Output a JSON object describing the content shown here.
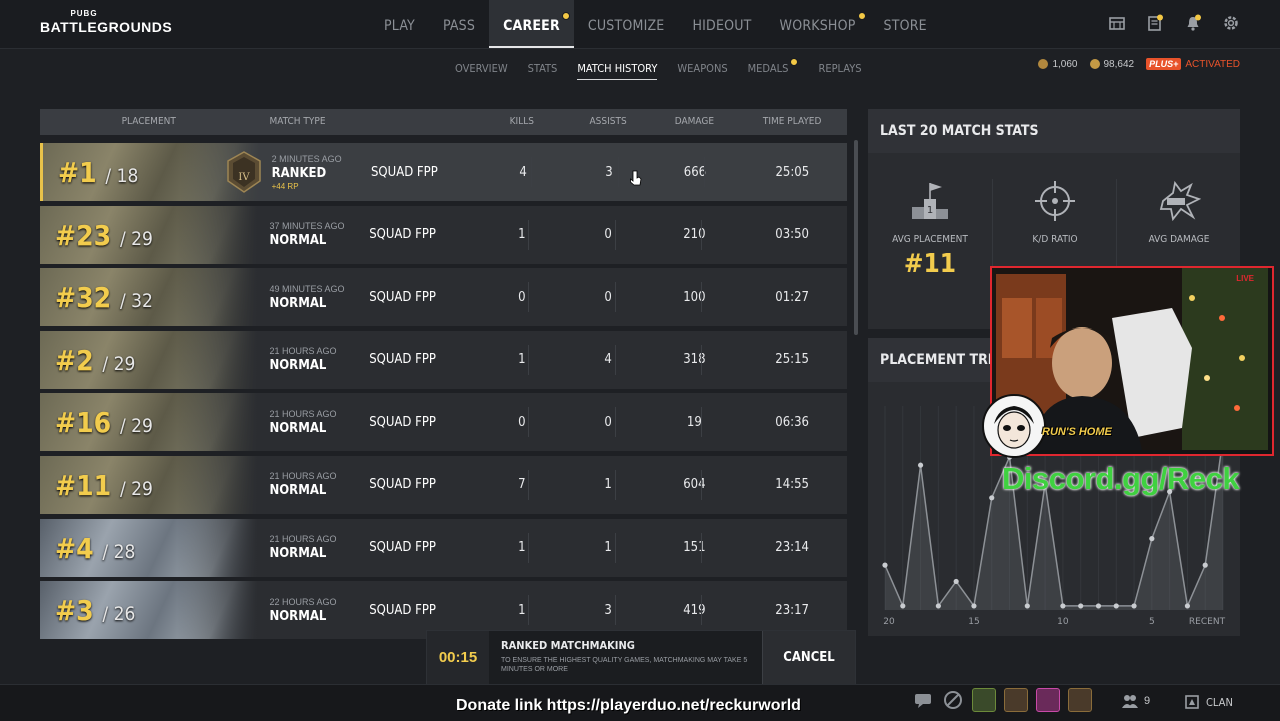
{
  "logo": {
    "small": "PUBG",
    "big": "BATTLEGROUNDS"
  },
  "main_nav": [
    {
      "label": "PLAY",
      "active": false,
      "dot": false
    },
    {
      "label": "PASS",
      "active": false,
      "dot": false
    },
    {
      "label": "CAREER",
      "active": true,
      "dot": true
    },
    {
      "label": "CUSTOMIZE",
      "active": false,
      "dot": false
    },
    {
      "label": "HIDEOUT",
      "active": false,
      "dot": false
    },
    {
      "label": "WORKSHOP",
      "active": false,
      "dot": true
    },
    {
      "label": "STORE",
      "active": false,
      "dot": false
    }
  ],
  "top_icons": [
    "inventory-icon",
    "mission-icon",
    "notification-bell-icon",
    "gear-icon"
  ],
  "sub_nav": [
    {
      "label": "OVERVIEW",
      "active": false
    },
    {
      "label": "STATS",
      "active": false
    },
    {
      "label": "MATCH HISTORY",
      "active": true
    },
    {
      "label": "WEAPONS",
      "active": false
    },
    {
      "label": "MEDALS",
      "active": false,
      "dot": true
    },
    {
      "label": "REPLAYS",
      "active": false
    }
  ],
  "currency": {
    "bp": "1,060",
    "g_coin": "98,642",
    "plus_label": "PLUS+",
    "plus_status": "ACTIVATED"
  },
  "table": {
    "headers": {
      "placement": "PLACEMENT",
      "match_type": "MATCH TYPE",
      "kills": "KILLS",
      "assists": "ASSISTS",
      "damage": "DAMAGE",
      "time_played": "TIME PLAYED"
    },
    "rows": [
      {
        "place": "#1",
        "total": "/ 18",
        "time_ago": "2 MINUTES AGO",
        "type": "RANKED",
        "rp": "+44 RP",
        "mode": "SQUAD FPP",
        "kills": "4",
        "assists": "3",
        "damage": "666",
        "time": "25:05",
        "map": "erangel",
        "badge": "IV"
      },
      {
        "place": "#23",
        "total": "/ 29",
        "time_ago": "37 MINUTES AGO",
        "type": "NORMAL",
        "mode": "SQUAD FPP",
        "kills": "1",
        "assists": "0",
        "damage": "210",
        "time": "03:50",
        "map": "erangel"
      },
      {
        "place": "#32",
        "total": "/ 32",
        "time_ago": "49 MINUTES AGO",
        "type": "NORMAL",
        "mode": "SQUAD FPP",
        "kills": "0",
        "assists": "0",
        "damage": "100",
        "time": "01:27",
        "map": "erangel"
      },
      {
        "place": "#2",
        "total": "/ 29",
        "time_ago": "21 HOURS AGO",
        "type": "NORMAL",
        "mode": "SQUAD FPP",
        "kills": "1",
        "assists": "4",
        "damage": "318",
        "time": "25:15",
        "map": "erangel"
      },
      {
        "place": "#16",
        "total": "/ 29",
        "time_ago": "21 HOURS AGO",
        "type": "NORMAL",
        "mode": "SQUAD FPP",
        "kills": "0",
        "assists": "0",
        "damage": "19",
        "time": "06:36",
        "map": "erangel"
      },
      {
        "place": "#11",
        "total": "/ 29",
        "time_ago": "21 HOURS AGO",
        "type": "NORMAL",
        "mode": "SQUAD FPP",
        "kills": "7",
        "assists": "1",
        "damage": "604",
        "time": "14:55",
        "map": "erangel"
      },
      {
        "place": "#4",
        "total": "/ 28",
        "time_ago": "21 HOURS AGO",
        "type": "NORMAL",
        "mode": "SQUAD FPP",
        "kills": "1",
        "assists": "1",
        "damage": "151",
        "time": "23:14",
        "map": "vikendi"
      },
      {
        "place": "#3",
        "total": "/ 26",
        "time_ago": "22 HOURS AGO",
        "type": "NORMAL",
        "mode": "SQUAD FPP",
        "kills": "1",
        "assists": "3",
        "damage": "419",
        "time": "23:17",
        "map": "vikendi"
      }
    ]
  },
  "last20": {
    "title": "LAST 20 MATCH STATS",
    "avg_placement_label": "AVG PLACEMENT",
    "avg_placement_value": "#11",
    "kd_label": "K/D RATIO",
    "avg_damage_label": "AVG DAMAGE"
  },
  "trend": {
    "title": "PLACEMENT TREND",
    "x_labels": [
      "20",
      "15",
      "10",
      "5",
      "RECENT"
    ],
    "points": [
      0.22,
      0.02,
      0.71,
      0.02,
      0.14,
      0.02,
      0.55,
      0.75,
      0.02,
      0.62,
      0.02,
      0.02,
      0.02,
      0.02,
      0.02,
      0.35,
      0.58,
      0.02,
      0.22,
      0.84
    ]
  },
  "overlay": {
    "stream_badge": "LIVE",
    "discord": "Discord.gg/Reck",
    "donate": "Donate link https://playerduo.net/reckurworld",
    "streamer_tag": "RUN'S HOME"
  },
  "queue": {
    "timer": "00:15",
    "title": "RANKED MATCHMAKING",
    "description": "TO ENSURE THE HIGHEST QUALITY GAMES, MATCHMAKING MAY TAKE 5 MINUTES OR MORE",
    "cancel": "CANCEL"
  },
  "bottom": {
    "party_count": "9",
    "clan_label": "CLAN"
  }
}
